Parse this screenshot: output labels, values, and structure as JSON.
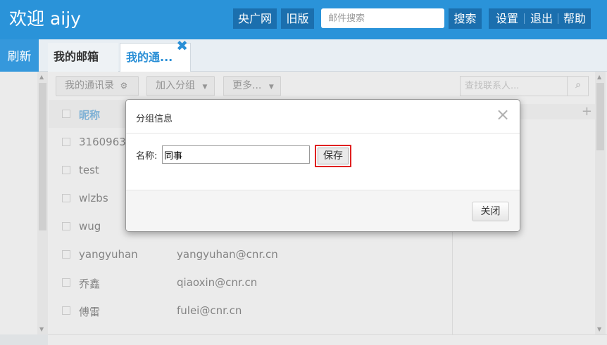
{
  "header": {
    "welcome": "欢迎 aijy",
    "cnr_link": "央广网",
    "old_version": "旧版",
    "search_placeholder": "邮件搜索",
    "search_button": "搜索",
    "settings": "设置",
    "logout": "退出",
    "help": "帮助"
  },
  "tabs": {
    "refresh": "刷新",
    "mail": "我的邮箱",
    "contacts": "我的通...",
    "close_glyph": "✖"
  },
  "toolbar": {
    "contacts": "我的通讯录",
    "add_group": "加入分组",
    "more": "更多...",
    "search_placeholder": "查找联系人..."
  },
  "list": {
    "header_name": "昵称",
    "rows": [
      {
        "name": "31609630",
        "email": ""
      },
      {
        "name": "test",
        "email": ""
      },
      {
        "name": "wlzbs",
        "email": ""
      },
      {
        "name": "wug",
        "email": ""
      },
      {
        "name": "yangyuhan",
        "email": "yangyuhan@cnr.cn"
      },
      {
        "name": "乔鑫",
        "email": "qiaoxin@cnr.cn"
      },
      {
        "name": "傅雷",
        "email": "fulei@cnr.cn"
      }
    ]
  },
  "groups": {
    "add_glyph": "+"
  },
  "dialog": {
    "title": "分组信息",
    "name_label": "名称:",
    "name_value": "同事",
    "save": "保存",
    "close": "关闭",
    "close_glyph": "×",
    "highlight_color": "#e02020"
  },
  "colors": {
    "header_bg": "#2a93d9",
    "header_button_bg": "#1b6fae",
    "active_tab_text": "#2a8fd6"
  }
}
